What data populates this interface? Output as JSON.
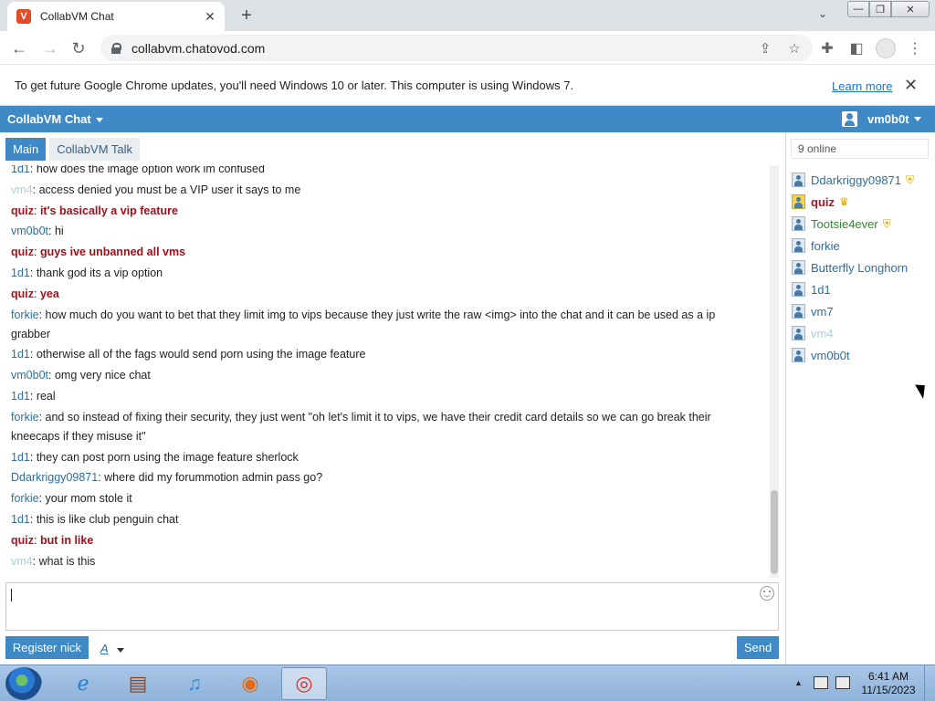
{
  "browser": {
    "tab_title": "CollabVM Chat",
    "tab_favicon": "V",
    "url": "collabvm.chatovod.com",
    "infobar_text": "To get future Google Chrome updates, you'll need Windows 10 or later. This computer is using Windows 7.",
    "infobar_link": "Learn more"
  },
  "app": {
    "title": "CollabVM Chat",
    "username": "vm0b0t",
    "tabs": [
      {
        "label": "Main"
      },
      {
        "label": "CollabVM Talk"
      }
    ],
    "messages": [
      {
        "nick": "1d1",
        "sep": ": ",
        "text": "how does the image option work im confused"
      },
      {
        "nick": "vm4",
        "sep": ": ",
        "text": "access denied you must be a VIP user it says to me"
      },
      {
        "nick": "quiz",
        "sep": ": ",
        "text": "it's basically a vip feature"
      },
      {
        "nick": "vm0b0t",
        "sep": ": ",
        "text": "hi"
      },
      {
        "nick": "quiz",
        "sep": ": ",
        "text": "guys ive unbanned all vms"
      },
      {
        "nick": "1d1",
        "sep": ": ",
        "text": "thank god its a vip option"
      },
      {
        "nick": "quiz",
        "sep": ": ",
        "text": "yea"
      },
      {
        "nick": "forkie",
        "sep": ": ",
        "text": "how much do you want to bet that they limit img to vips because they just write the raw <img> into the chat and it can be used as a ip grabber"
      },
      {
        "nick": "1d1",
        "sep": ": ",
        "text": "otherwise all of the fags would send porn using the image feature"
      },
      {
        "nick": "vm0b0t",
        "sep": ": ",
        "text": "omg very nice chat"
      },
      {
        "nick": "1d1",
        "sep": ": ",
        "text": "real"
      },
      {
        "nick": "forkie",
        "sep": ": ",
        "text": "and so instead of fixing their security, they just went \"oh let's limit it to vips, we have their credit card details so we can go break their kneecaps if they misuse it\""
      },
      {
        "nick": "1d1",
        "sep": ": ",
        "text": "they can post porn using the image feature sherlock"
      },
      {
        "nick": "Ddarkriggy09871",
        "sep": ": ",
        "text": "where did my forummotion admin pass go?"
      },
      {
        "nick": "forkie",
        "sep": ": ",
        "text": "your mom stole it"
      },
      {
        "nick": "1d1",
        "sep": ": ",
        "text": "this is like club penguin chat"
      },
      {
        "nick": "quiz",
        "sep": ": ",
        "text": "but in like"
      },
      {
        "nick": "vm4",
        "sep": ": ",
        "text": "what is this"
      }
    ],
    "register_label": "Register nick",
    "font_label": "A",
    "send_label": "Send",
    "online_count": "9 online",
    "users": [
      {
        "name": "Ddarkriggy09871",
        "badge": "shield",
        "style": "normal"
      },
      {
        "name": "quiz",
        "badge": "crown",
        "style": "quiz"
      },
      {
        "name": "Tootsie4ever",
        "badge": "shield",
        "style": "tootsie"
      },
      {
        "name": "forkie",
        "badge": "",
        "style": "normal"
      },
      {
        "name": "Butterfly Longhorn",
        "badge": "",
        "style": "normal"
      },
      {
        "name": "1d1",
        "badge": "",
        "style": "normal"
      },
      {
        "name": "vm7",
        "badge": "",
        "style": "normal"
      },
      {
        "name": "vm4",
        "badge": "",
        "style": "vm4"
      },
      {
        "name": "vm0b0t",
        "badge": "",
        "style": "normal"
      }
    ]
  },
  "taskbar": {
    "time": "6:41 AM",
    "date": "11/15/2023",
    "apps": [
      "internet-explorer",
      "winrar",
      "itunes",
      "firefox",
      "chrome"
    ]
  },
  "colors": {
    "accent": "#3e89c6",
    "quiz_nick": "#b0141f",
    "vm4_nick": "#a8d0dc",
    "tootsie_nick": "#2e8b2e"
  }
}
